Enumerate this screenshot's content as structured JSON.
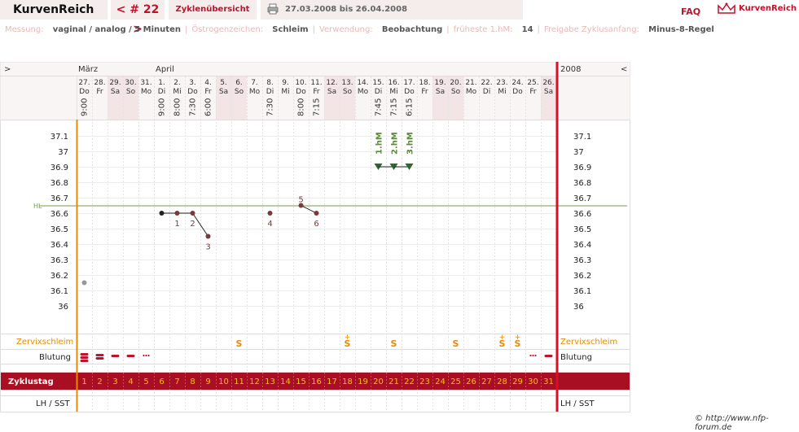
{
  "header": {
    "brand": "KurvenReich",
    "cycle_number": "< # 22 >",
    "overview_label": "Zyklenübersicht",
    "date_range": "27.03.2008 bis 26.04.2008",
    "faq": "FAQ",
    "brand_right": "KurvenReich"
  },
  "settings": [
    {
      "label": "Messung:",
      "value": "vaginal / analog / 5 Minuten"
    },
    {
      "label": "Östrogenzeichen:",
      "value": "Schleim"
    },
    {
      "label": "Verwendung:",
      "value": "Beobachtung"
    },
    {
      "label": "früheste 1.hM:",
      "value": "14"
    },
    {
      "label": "Freigabe Zyklusanfang:",
      "value": "Minus-8-Regel"
    }
  ],
  "nav": {
    "prev": ">",
    "next": "<",
    "year": "2008"
  },
  "months": [
    {
      "label": "März",
      "col": 0
    },
    {
      "label": "April",
      "col": 5
    }
  ],
  "days": [
    {
      "d": "27.",
      "w": "Do",
      "t": "9:00",
      "we": false
    },
    {
      "d": "28.",
      "w": "Fr",
      "t": "",
      "we": false
    },
    {
      "d": "29.",
      "w": "Sa",
      "t": "",
      "we": true
    },
    {
      "d": "30.",
      "w": "So",
      "t": "",
      "we": true
    },
    {
      "d": "31.",
      "w": "Mo",
      "t": "",
      "we": false
    },
    {
      "d": "1.",
      "w": "Di",
      "t": "9:00",
      "we": false
    },
    {
      "d": "2.",
      "w": "Mi",
      "t": "8:00",
      "we": false
    },
    {
      "d": "3.",
      "w": "Do",
      "t": "7:30",
      "we": false
    },
    {
      "d": "4.",
      "w": "Fr",
      "t": "6:00",
      "we": false
    },
    {
      "d": "5.",
      "w": "Sa",
      "t": "",
      "we": true
    },
    {
      "d": "6.",
      "w": "So",
      "t": "",
      "we": true
    },
    {
      "d": "7.",
      "w": "Mo",
      "t": "",
      "we": false
    },
    {
      "d": "8.",
      "w": "Di",
      "t": "7:30",
      "we": false
    },
    {
      "d": "9.",
      "w": "Mi",
      "t": "",
      "we": false
    },
    {
      "d": "10.",
      "w": "Do",
      "t": "8:00",
      "we": false
    },
    {
      "d": "11.",
      "w": "Fr",
      "t": "7:15",
      "we": false
    },
    {
      "d": "12.",
      "w": "Sa",
      "t": "",
      "we": true
    },
    {
      "d": "13.",
      "w": "So",
      "t": "",
      "we": true
    },
    {
      "d": "14.",
      "w": "Mo",
      "t": "",
      "we": false
    },
    {
      "d": "15.",
      "w": "Di",
      "t": "7:45",
      "we": false
    },
    {
      "d": "16.",
      "w": "Mi",
      "t": "7:15",
      "we": false
    },
    {
      "d": "17.",
      "w": "Do",
      "t": "6:15",
      "we": false
    },
    {
      "d": "18.",
      "w": "Fr",
      "t": "",
      "we": false
    },
    {
      "d": "19.",
      "w": "Sa",
      "t": "",
      "we": true
    },
    {
      "d": "20.",
      "w": "So",
      "t": "",
      "we": true
    },
    {
      "d": "21.",
      "w": "Mo",
      "t": "",
      "we": false
    },
    {
      "d": "22.",
      "w": "Di",
      "t": "",
      "we": false
    },
    {
      "d": "23.",
      "w": "Mi",
      "t": "",
      "we": false
    },
    {
      "d": "24.",
      "w": "Do",
      "t": "",
      "we": false
    },
    {
      "d": "25.",
      "w": "Fr",
      "t": "",
      "we": false
    },
    {
      "d": "26.",
      "w": "Sa",
      "t": "",
      "we": true
    }
  ],
  "temp_axis": {
    "ticks": [
      "37.1",
      "37",
      "36.9",
      "36.8",
      "36.7",
      "36.6",
      "36.5",
      "36.4",
      "36.3",
      "36.2",
      "36.1",
      "36"
    ],
    "hl_label": "HL",
    "hl_value": 36.65
  },
  "chart_data": {
    "type": "line",
    "title": "",
    "xlabel": "Zyklustag",
    "ylabel": "",
    "ylim": [
      36.0,
      37.1
    ],
    "x": [
      1,
      6,
      7,
      8,
      9,
      13,
      15,
      16
    ],
    "values": [
      36.15,
      36.6,
      36.6,
      36.6,
      36.45,
      36.6,
      36.65,
      36.6
    ],
    "excluded_day": 1,
    "segments": [
      [
        6,
        7,
        8,
        9
      ],
      [
        15,
        16
      ]
    ],
    "point_labels": [
      {
        "day": 7,
        "label": "1"
      },
      {
        "day": 8,
        "label": "2"
      },
      {
        "day": 9,
        "label": "3"
      },
      {
        "day": 13,
        "label": "4"
      },
      {
        "day": 15,
        "label": "5"
      },
      {
        "day": 16,
        "label": "6"
      }
    ],
    "high_measurements": [
      {
        "day": 20,
        "label": "1.hM",
        "value": 36.9
      },
      {
        "day": 21,
        "label": "2.hM",
        "value": 36.9
      },
      {
        "day": 22,
        "label": "3.hM",
        "value": 36.9
      }
    ],
    "cover_line": 36.65
  },
  "rows": {
    "mucus_label": "Zervixschleim",
    "bleeding_label": "Blutung",
    "cycle_day_label": "Zyklustag",
    "lh_label": "LH / SST"
  },
  "mucus": [
    {
      "day": 11,
      "sym": "S"
    },
    {
      "day": 18,
      "sym": "S+"
    },
    {
      "day": 21,
      "sym": "S"
    },
    {
      "day": 25,
      "sym": "S"
    },
    {
      "day": 28,
      "sym": "S+"
    },
    {
      "day": 29,
      "sym": "S+"
    }
  ],
  "bleeding": [
    {
      "day": 1,
      "level": "heavy"
    },
    {
      "day": 2,
      "level": "medium"
    },
    {
      "day": 3,
      "level": "normal"
    },
    {
      "day": 4,
      "level": "normal"
    },
    {
      "day": 5,
      "level": "spotting"
    },
    {
      "day": 30,
      "level": "spotting"
    },
    {
      "day": 31,
      "level": "normal"
    }
  ],
  "copyright": "© http://www.nfp-forum.de",
  "colors": {
    "accent": "#c0122c",
    "orange": "#e88a00",
    "green": "#5a8a3a",
    "point": "#7a3a3a"
  }
}
